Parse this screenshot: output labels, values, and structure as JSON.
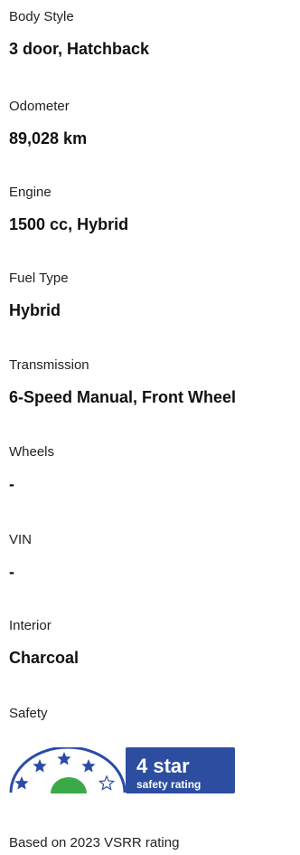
{
  "specs": [
    {
      "label": "Body Style",
      "value": "3 door, Hatchback"
    },
    {
      "label": "Odometer",
      "value": "89,028 km"
    },
    {
      "label": "Engine",
      "value": "1500 cc, Hybrid"
    },
    {
      "label": "Fuel Type",
      "value": "Hybrid"
    },
    {
      "label": "Transmission",
      "value": "6-Speed Manual, Front Wheel"
    },
    {
      "label": "Wheels",
      "value": "-"
    },
    {
      "label": "VIN",
      "value": "-"
    },
    {
      "label": "Interior",
      "value": "Charcoal"
    }
  ],
  "safety": {
    "label": "Safety",
    "rating": {
      "stars": 4,
      "max_stars": 5,
      "star_text": "4 star",
      "subtitle": "safety rating"
    },
    "footnote": "Based on 2023 VSRR rating"
  },
  "colors": {
    "badge_blue": "#2c4da0",
    "star_blue": "#2b4ba8",
    "semicircle_green": "#3aaa48",
    "badge_text": "#ffffff"
  },
  "icons": {
    "filled_star": "star-icon",
    "empty_star": "star-outline-icon"
  }
}
